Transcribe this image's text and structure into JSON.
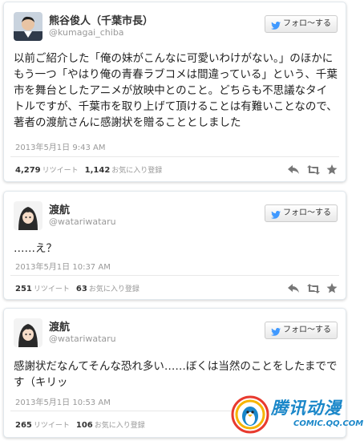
{
  "follow_label": "フォロ～する",
  "tweets": [
    {
      "name": "熊谷俊人（千葉市長）",
      "handle": "@kumagai_chiba",
      "text": "以前ご紹介した「俺の妹がこんなに可愛いわけがない。」のほかにもう一つ「やはり俺の青春ラブコメは間違っている」という、千葉市を舞台としたアニメが放映中とのこと。どちらも不思議なタイトルですが、千葉市を取り上げて頂けることは有難いことなので、著者の渡航さんに感謝状を贈ることとしました",
      "time": "2013年5月1日 9:43 AM",
      "retweets": "4,279",
      "retweets_label": "リツイート",
      "favorites": "1,142",
      "favorites_label": "お気に入り登録"
    },
    {
      "name": "渡航",
      "handle": "@watariwataru",
      "text": "……え？",
      "time": "2013年5月1日 10:37 AM",
      "retweets": "251",
      "retweets_label": "リツイート",
      "favorites": "63",
      "favorites_label": "お気に入り登録"
    },
    {
      "name": "渡航",
      "handle": "@watariwataru",
      "text": "感謝状だなんてそんな恐れ多い……ぼくは当然のことをしたまでです（キリッ",
      "time": "2013年5月1日 10:53 AM",
      "retweets": "265",
      "retweets_label": "リツイート",
      "favorites": "106",
      "favorites_label": "お気に入り登録"
    }
  ],
  "watermark": {
    "text": "腾讯动漫",
    "url": "COMIC.QQ.COM"
  },
  "colors": {
    "twitter_blue": "#4099ff",
    "watermark_blue": "#1a87c9",
    "muted": "#999999"
  },
  "icons": [
    "twitter-bird-icon",
    "reply-icon",
    "retweet-icon",
    "favorite-star-icon"
  ]
}
